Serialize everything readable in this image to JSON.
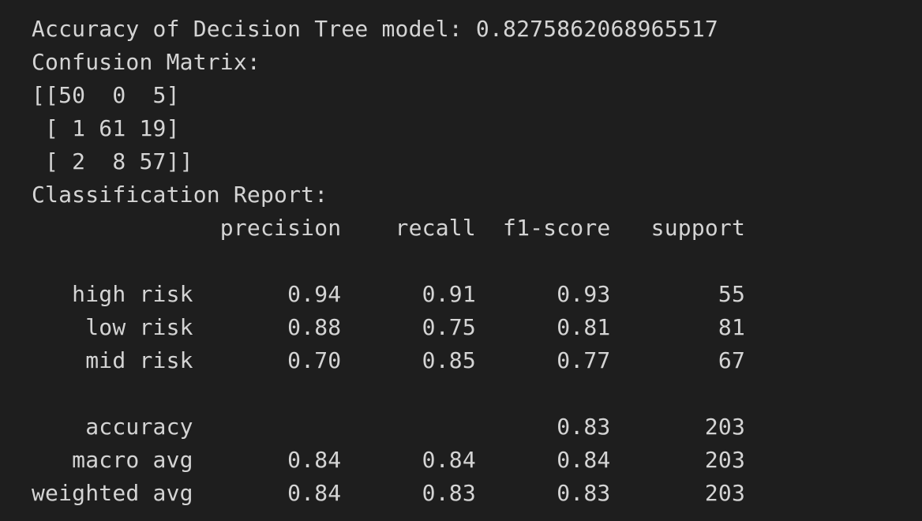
{
  "output": {
    "accuracy_line": "Accuracy of Decision Tree model: 0.8275862068965517",
    "confusion_title": "Confusion Matrix:",
    "matrix_rows": [
      "[[50  0  5]",
      " [ 1 61 19]",
      " [ 2  8 57]]"
    ],
    "report_title": "Classification Report:",
    "report_header": "              precision    recall  f1-score   support",
    "blank": "",
    "report_rows": [
      "   high risk       0.94      0.91      0.93        55",
      "    low risk       0.88      0.75      0.81        81",
      "    mid risk       0.70      0.85      0.77        67"
    ],
    "summary_rows": [
      "    accuracy                           0.83       203",
      "   macro avg       0.84      0.84      0.84       203",
      "weighted avg       0.84      0.83      0.83       203"
    ]
  }
}
